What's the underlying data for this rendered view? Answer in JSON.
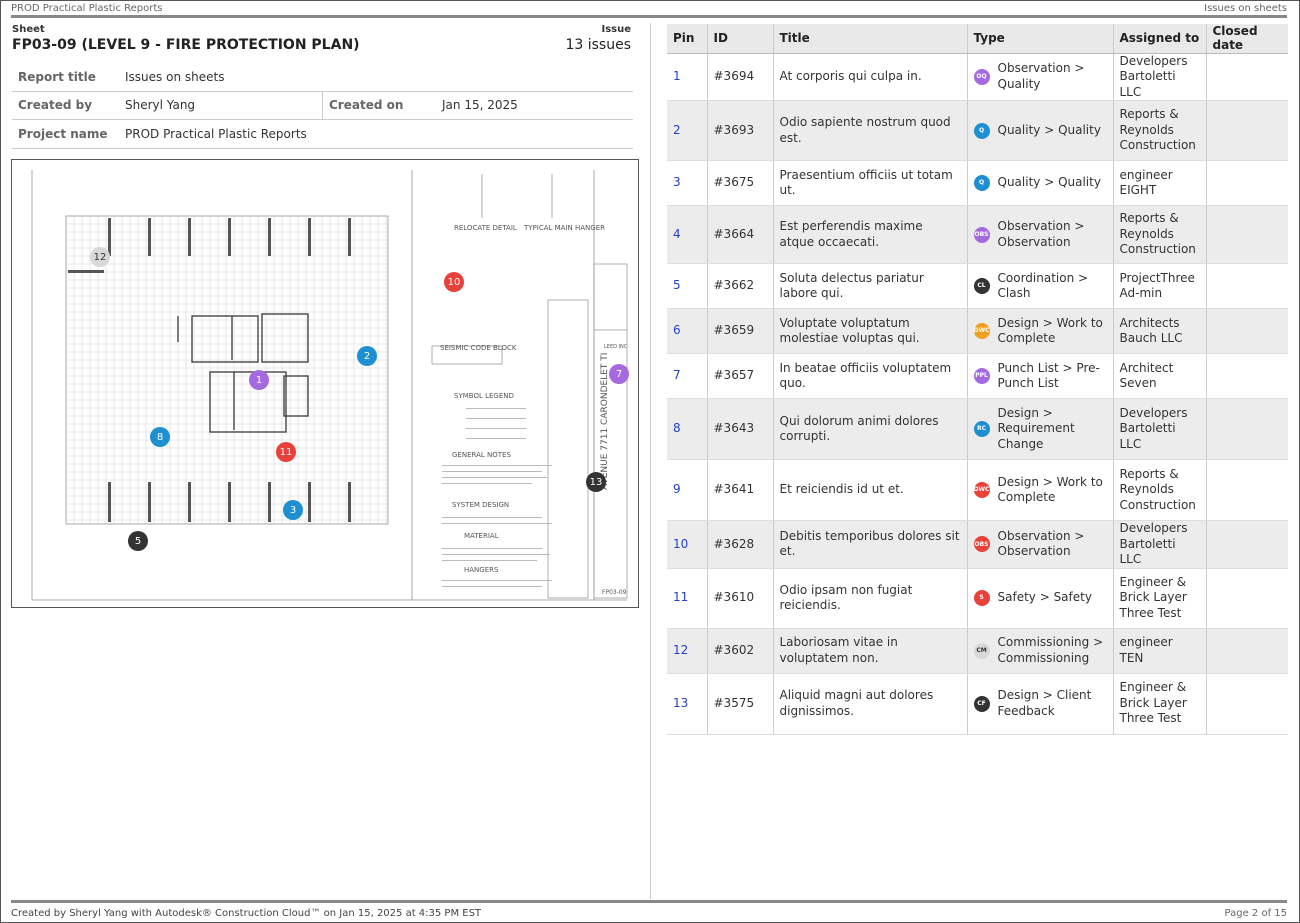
{
  "header": {
    "left": "PROD Practical Plastic Reports",
    "right": "Issues on sheets"
  },
  "sheet": {
    "label": "Sheet",
    "title": "FP03-09 (LEVEL 9 - FIRE PROTECTION PLAN)",
    "issue_label": "Issue",
    "issue_count": "13 issues"
  },
  "meta": {
    "report_title_key": "Report title",
    "report_title": "Issues on sheets",
    "created_by_key": "Created by",
    "created_by": "Sheryl Yang",
    "created_on_key": "Created on",
    "created_on": "Jan 15, 2025",
    "project_name_key": "Project name",
    "project_name": "PROD Practical Plastic Reports"
  },
  "plan_labels": {
    "relocate": "RELOCATE DETAIL",
    "hanger": "TYPICAL MAIN HANGER",
    "seismic": "SEISMIC CODE BLOCK",
    "symbol": "SYMBOL LEGEND",
    "general": "GENERAL NOTES",
    "system": "SYSTEM DESIGN",
    "material": "MATERIAL",
    "hangers": "HANGERS",
    "address": "AVENUE 7711 CARONDELET TI",
    "sheet_no": "FP03-09",
    "leed": "LEED INC"
  },
  "pins": [
    {
      "n": "1",
      "color": "#a66ae0"
    },
    {
      "n": "2",
      "color": "#1e90d2"
    },
    {
      "n": "3",
      "color": "#1e90d2"
    },
    {
      "n": "5",
      "color": "#333333"
    },
    {
      "n": "7",
      "color": "#a66ae0"
    },
    {
      "n": "8",
      "color": "#1e90d2"
    },
    {
      "n": "10",
      "color": "#e8413a"
    },
    {
      "n": "11",
      "color": "#e8413a"
    },
    {
      "n": "12",
      "color": "#d8d8d8"
    },
    {
      "n": "13",
      "color": "#333333"
    }
  ],
  "table": {
    "headers": [
      "Pin",
      "ID",
      "Title",
      "Type",
      "Assigned to",
      "Closed date"
    ],
    "rows": [
      {
        "pin": "1",
        "id": "#3694",
        "title": "At corporis qui culpa in.",
        "badge": "OQ",
        "badge_color": "#a66ae0",
        "type": "Observation > Quality",
        "assigned": "Developers Bartoletti LLC",
        "closed": ""
      },
      {
        "pin": "2",
        "id": "#3693",
        "title": "Odio sapiente nostrum quod est.",
        "badge": "Q",
        "badge_color": "#1e90d2",
        "type": "Quality > Quality",
        "assigned": "Reports & Reynolds Construction",
        "closed": ""
      },
      {
        "pin": "3",
        "id": "#3675",
        "title": "Praesentium officiis ut totam ut.",
        "badge": "Q",
        "badge_color": "#1e90d2",
        "type": "Quality > Quality",
        "assigned": "engineer EIGHT",
        "closed": ""
      },
      {
        "pin": "4",
        "id": "#3664",
        "title": "Est perferendis maxime atque occaecati.",
        "badge": "OBS",
        "badge_color": "#a66ae0",
        "type": "Observation > Observation",
        "assigned": "Reports & Reynolds Construction",
        "closed": ""
      },
      {
        "pin": "5",
        "id": "#3662",
        "title": "Soluta delectus pariatur labore qui.",
        "badge": "CL",
        "badge_color": "#333333",
        "type": "Coordination > Clash",
        "assigned": "ProjectThree Ad-min",
        "closed": ""
      },
      {
        "pin": "6",
        "id": "#3659",
        "title": "Voluptate voluptatum molestiae voluptas qui.",
        "badge": "DWC",
        "badge_color": "#f0a020",
        "type": "Design > Work to Complete",
        "assigned": "Architects Bauch LLC",
        "closed": ""
      },
      {
        "pin": "7",
        "id": "#3657",
        "title": "In beatae officiis voluptatem quo.",
        "badge": "PPL",
        "badge_color": "#a66ae0",
        "type": "Punch List > Pre-Punch List",
        "assigned": "Architect Seven",
        "closed": ""
      },
      {
        "pin": "8",
        "id": "#3643",
        "title": "Qui dolorum animi dolores corrupti.",
        "badge": "RC",
        "badge_color": "#1e90d2",
        "type": "Design > Requirement Change",
        "assigned": "Developers Bartoletti LLC",
        "closed": ""
      },
      {
        "pin": "9",
        "id": "#3641",
        "title": "Et reiciendis id ut et.",
        "badge": "DWC",
        "badge_color": "#e8413a",
        "type": "Design > Work to Complete",
        "assigned": "Reports & Reynolds Construction",
        "closed": ""
      },
      {
        "pin": "10",
        "id": "#3628",
        "title": "Debitis temporibus dolores sit et.",
        "badge": "OBS",
        "badge_color": "#e8413a",
        "type": "Observation > Observation",
        "assigned": "Developers Bartoletti LLC",
        "closed": ""
      },
      {
        "pin": "11",
        "id": "#3610",
        "title": "Odio ipsam non fugiat reiciendis.",
        "badge": "S",
        "badge_color": "#e8413a",
        "type": "Safety > Safety",
        "assigned": "Engineer & Brick Layer Three Test",
        "closed": ""
      },
      {
        "pin": "12",
        "id": "#3602",
        "title": "Laboriosam vitae in voluptatem non.",
        "badge": "CM",
        "badge_color": "#d8d8d8",
        "type": "Commissioning > Commissioning",
        "assigned": "engineer TEN",
        "closed": ""
      },
      {
        "pin": "13",
        "id": "#3575",
        "title": "Aliquid magni aut dolores dignissimos.",
        "badge": "CF",
        "badge_color": "#333333",
        "type": "Design > Client Feedback",
        "assigned": "Engineer & Brick Layer Three Test",
        "closed": ""
      }
    ]
  },
  "footer": {
    "left": "Created by Sheryl Yang with Autodesk® Construction Cloud™ on Jan 15, 2025 at 4:35 PM EST",
    "right": "Page 2 of 15"
  }
}
